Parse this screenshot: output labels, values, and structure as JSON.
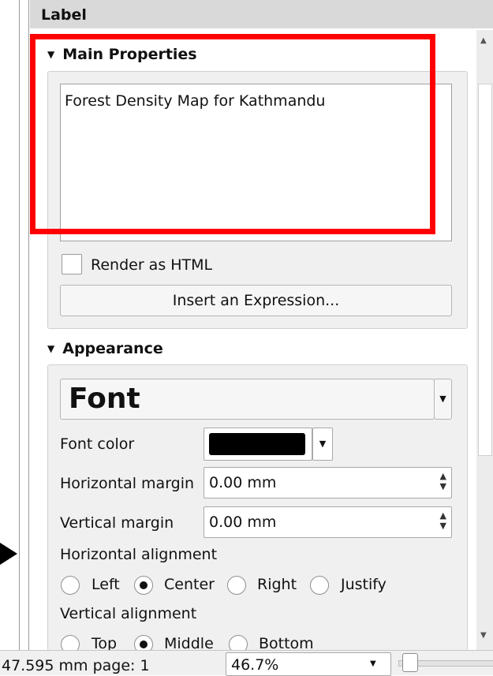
{
  "panel": {
    "header": "Label",
    "main_properties": {
      "title": "Main Properties",
      "text": "Forest Density Map for Kathmandu",
      "render_html_label": "Render as HTML",
      "render_html_checked": false,
      "insert_expression_label": "Insert an Expression..."
    },
    "appearance": {
      "title": "Appearance",
      "font_button_label": "Font",
      "font_color_label": "Font color",
      "font_color_value": "#000000",
      "horizontal_margin_label": "Horizontal margin",
      "horizontal_margin_value": "0.00 mm",
      "vertical_margin_label": "Vertical margin",
      "vertical_margin_value": "0.00 mm",
      "horizontal_alignment_label": "Horizontal alignment",
      "horizontal_options": [
        "Left",
        "Center",
        "Right",
        "Justify"
      ],
      "horizontal_selected": "Center",
      "vertical_alignment_label": "Vertical alignment",
      "vertical_options": [
        "Top",
        "Middle",
        "Bottom"
      ],
      "vertical_selected": "Middle"
    }
  },
  "status_bar": {
    "position_text": "47.595 mm page: 1",
    "zoom_value": "46.7%"
  },
  "highlight_color": "#ff0000"
}
